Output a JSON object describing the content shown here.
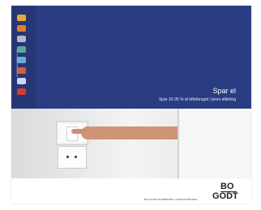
{
  "brochure": {
    "title": "Spar el",
    "subtitle": "Spar 10-35 % af elforbruget i jeres afdeling",
    "side_url": "www.boligselskaber.dk"
  },
  "sidebar_icons": [
    {
      "name": "sun-icon",
      "color": "#e6a832"
    },
    {
      "name": "radiator-icon",
      "color": "#e27f2d"
    },
    {
      "name": "building-icon",
      "color": "#b6b7c6"
    },
    {
      "name": "water-icon",
      "color": "#5aa7a0"
    },
    {
      "name": "appliance-icon",
      "color": "#6fa9d8"
    },
    {
      "name": "washing-machine-icon",
      "color": "#d75b3e"
    },
    {
      "name": "fence-icon",
      "color": "#cfd6e6"
    },
    {
      "name": "recycle-icon",
      "color": "#d33b2f"
    }
  ],
  "footer": {
    "organization": "BOLIGSELSKABERNES LANDSFORENING",
    "logo_top": "BO",
    "logo_bottom": "GODT"
  },
  "colors": {
    "banner": "#2a3d82",
    "strip": "#263774"
  }
}
